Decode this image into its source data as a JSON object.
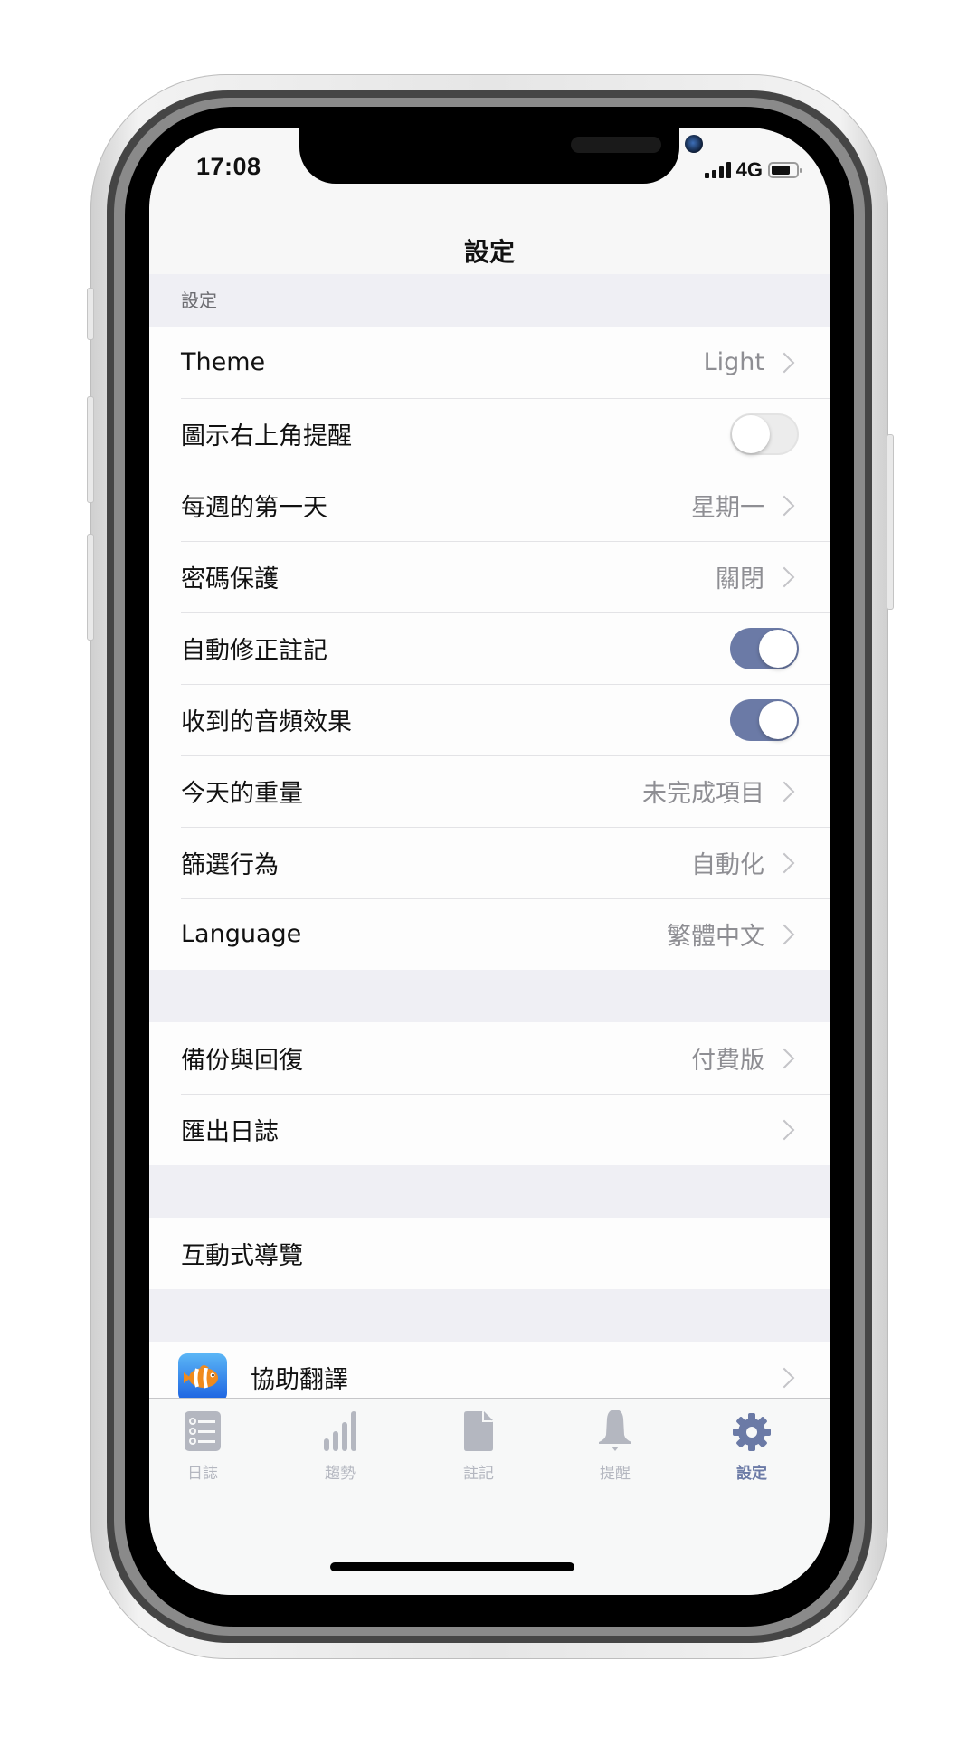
{
  "status_bar": {
    "time": "17:08",
    "network": "4G",
    "signal_icon": "signal-bars-icon",
    "battery_icon": "battery-icon"
  },
  "nav": {
    "title": "設定"
  },
  "sections": [
    {
      "header": "設定",
      "rows": [
        {
          "label": "Theme",
          "type": "disclosure",
          "value": "Light"
        },
        {
          "label": "圖示右上角提醒",
          "type": "toggle",
          "on": false
        },
        {
          "label": "每週的第一天",
          "type": "disclosure",
          "value": "星期一"
        },
        {
          "label": "密碼保護",
          "type": "disclosure",
          "value": "關閉"
        },
        {
          "label": "自動修正註記",
          "type": "toggle",
          "on": true
        },
        {
          "label": "收到的音頻效果",
          "type": "toggle",
          "on": true
        },
        {
          "label": "今天的重量",
          "type": "disclosure",
          "value": "未完成項目"
        },
        {
          "label": "篩選行為",
          "type": "disclosure",
          "value": "自動化"
        },
        {
          "label": "Language",
          "type": "disclosure",
          "value": "繁體中文"
        }
      ]
    },
    {
      "header": "",
      "rows": [
        {
          "label": "備份與回復",
          "type": "disclosure",
          "value": "付費版"
        },
        {
          "label": "匯出日誌",
          "type": "disclosure",
          "value": ""
        }
      ]
    },
    {
      "header": "",
      "rows": [
        {
          "label": "互動式導覽",
          "type": "plain"
        }
      ]
    },
    {
      "header": "",
      "rows": [
        {
          "label": "協助翻譯",
          "type": "disclosure",
          "icon": "clownfish-app-icon"
        }
      ]
    }
  ],
  "tabbar": {
    "items": [
      {
        "label": "日誌",
        "icon": "list-icon",
        "active": false
      },
      {
        "label": "趨勢",
        "icon": "bar-chart-icon",
        "active": false
      },
      {
        "label": "註記",
        "icon": "document-icon",
        "active": false
      },
      {
        "label": "提醒",
        "icon": "bell-icon",
        "active": false
      },
      {
        "label": "設定",
        "icon": "gear-icon",
        "active": true
      }
    ]
  },
  "colors": {
    "accent": "#6b7aa6",
    "inactive_tab": "#b4b7c0",
    "secondary_text": "#8e8e93",
    "grouped_background": "#efeff4"
  }
}
